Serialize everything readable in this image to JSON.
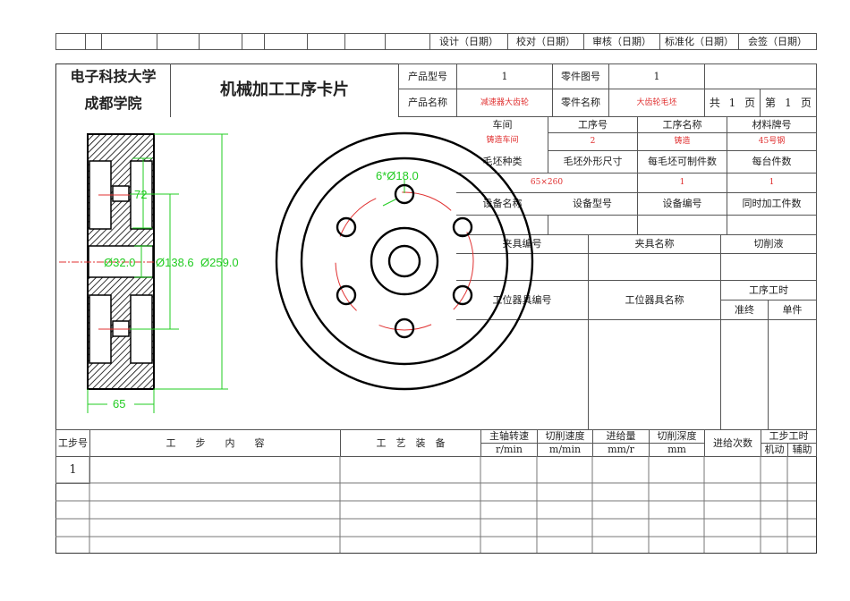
{
  "signoff": [
    "设计（日期）",
    "校对（日期）",
    "审核（日期）",
    "标准化（日期）",
    "会签（日期）"
  ],
  "school": [
    "电子科技大学",
    "成都学院"
  ],
  "title": "机械加工工序卡片",
  "product_model_label": "产品型号",
  "product_model": "1",
  "part_no_label": "零件图号",
  "part_no": "1",
  "product_name_label": "产品名称",
  "product_name": "减速器大齿轮",
  "part_name_label": "零件名称",
  "part_name": "大齿轮毛坯",
  "pages": {
    "total_label": "共",
    "total": "1",
    "page_unit": "页",
    "current_label": "第",
    "current": "1"
  },
  "op": {
    "workshop_label": "车间",
    "workshop": "铸造车间",
    "op_no_label": "工序号",
    "op_no": "2",
    "op_name_label": "工序名称",
    "op_name": "铸造",
    "material_label": "材料牌号",
    "material": "45号钢",
    "blank_type_label": "毛坯种类",
    "blank_size_label": "毛坯外形尺寸",
    "blank_size": "65×260",
    "per_blank_label": "每毛坯可制件数",
    "per_blank": "1",
    "per_unit_label": "每台件数",
    "per_unit": "1",
    "equip_name_label": "设备名称",
    "equip_model_label": "设备型号",
    "equip_no_label": "设备编号",
    "simul_label": "同时加工件数",
    "fixture_no_label": "夹具编号",
    "fixture_name_label": "夹具名称",
    "coolant_label": "切削液",
    "tool_no_label": "工位器具编号",
    "tool_name_label": "工位器具名称",
    "op_time_label": "工序工时",
    "prep_label": "准终",
    "unit_label": "单件"
  },
  "steps": {
    "h_no": "工步号",
    "h_content": "工　　步　　内　　容",
    "h_equip": "工　艺　装　备",
    "h_speed": "主轴转速",
    "u_speed": "r/min",
    "h_cut": "切削速度",
    "u_cut": "m/min",
    "h_feed": "进给量",
    "u_feed": "mm/r",
    "h_depth": "切削深度",
    "u_depth": "mm",
    "h_passes": "进给次数",
    "h_time": "工步工时",
    "h_machine": "机动",
    "h_aux": "辅助",
    "rows": [
      "1"
    ]
  },
  "dims": {
    "d72": "72",
    "d32": "Ø32.0",
    "d138": "Ø138.6",
    "d259": "Ø259.0",
    "d65": "65",
    "holes": "6*Ø18.0"
  }
}
